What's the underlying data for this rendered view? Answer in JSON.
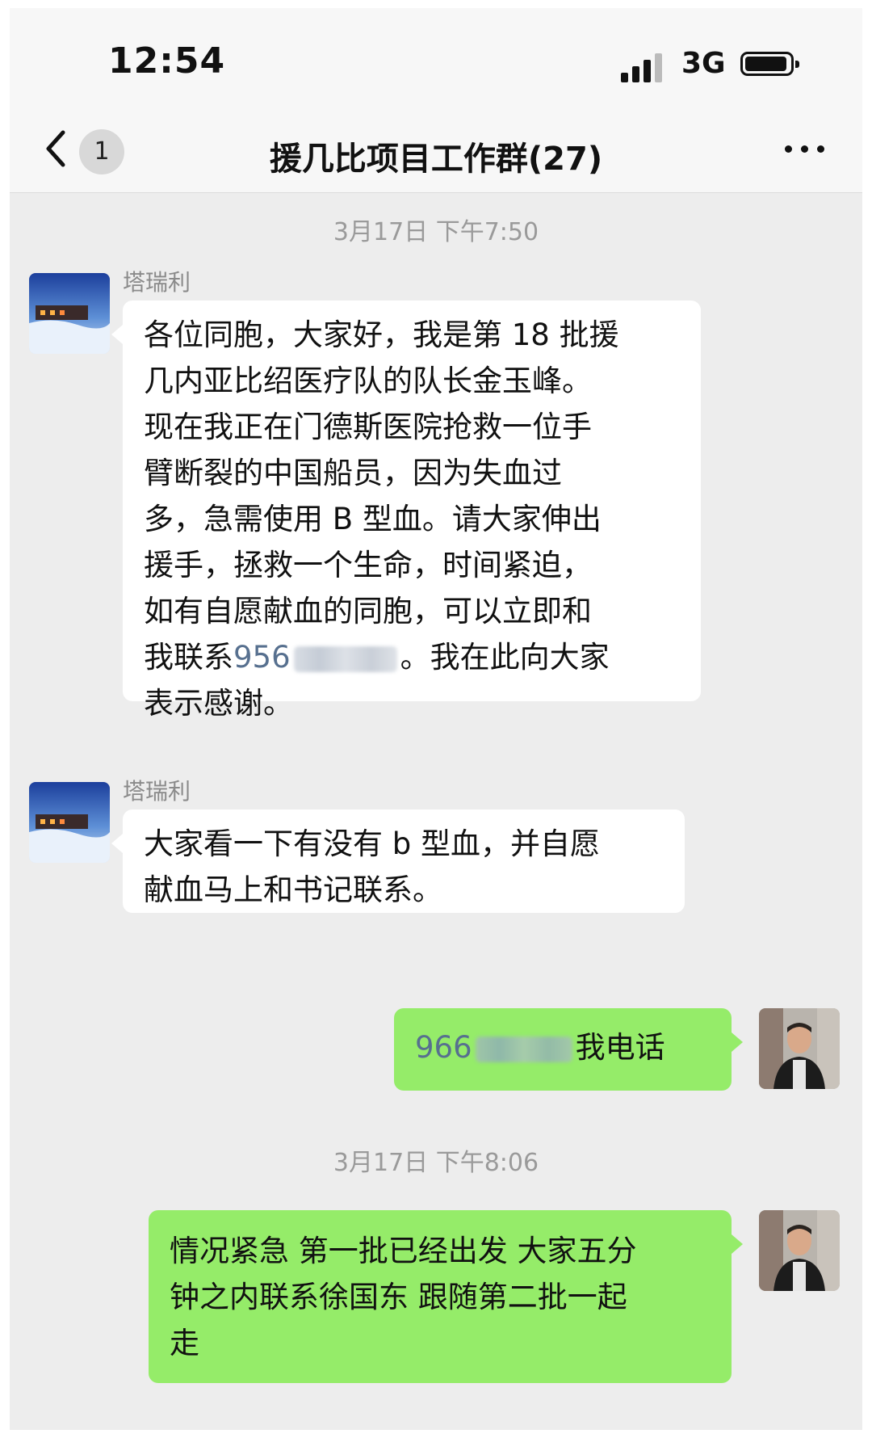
{
  "status_bar": {
    "time": "12:54",
    "network": "3G",
    "icons": [
      "signal-icon",
      "battery-icon"
    ]
  },
  "nav": {
    "back_icon": "chevron-left-icon",
    "unread_count": "1",
    "title": "援几比项目工作群(27)",
    "more_icon": "more-dots-icon"
  },
  "messages": [
    {
      "timestamp": "3月17日 下午7:50"
    },
    {
      "sender": "塔瑞利",
      "side": "left",
      "lines": [
        "各位同胞，大家好，我是第 18 批援",
        "几内亚比绍医疗队的队长金玉峰。",
        "现在我正在门德斯医院抢救一位手",
        "臂断裂的中国船员，因为失血过",
        "多，急需使用 B 型血。请大家伸出",
        "援手，拯救一个生命，时间紧迫，",
        "如有自愿献血的同胞，可以立即和"
      ],
      "line_before_phone": "我联系",
      "phone_visible": "956",
      "line_after_phone": "。我在此向大家",
      "last_line": "表示感谢。"
    },
    {
      "sender": "塔瑞利",
      "side": "left",
      "lines": [
        "大家看一下有没有 b 型血，并自愿",
        "献血马上和书记联系。"
      ]
    },
    {
      "side": "right",
      "phone_visible": "966",
      "text_after_phone": "我电话"
    },
    {
      "timestamp": "3月17日 下午8:06"
    },
    {
      "side": "right",
      "lines": [
        "情况紧急 第一批已经出发 大家五分",
        "钟之内联系徐国东 跟随第二批一起",
        "走"
      ]
    }
  ],
  "colors": {
    "chat_background": "#ededed",
    "left_bubble": "#ffffff",
    "right_bubble": "#95ec69",
    "phone_link": "#57708f",
    "timestamp_text": "#9a9a9a"
  }
}
